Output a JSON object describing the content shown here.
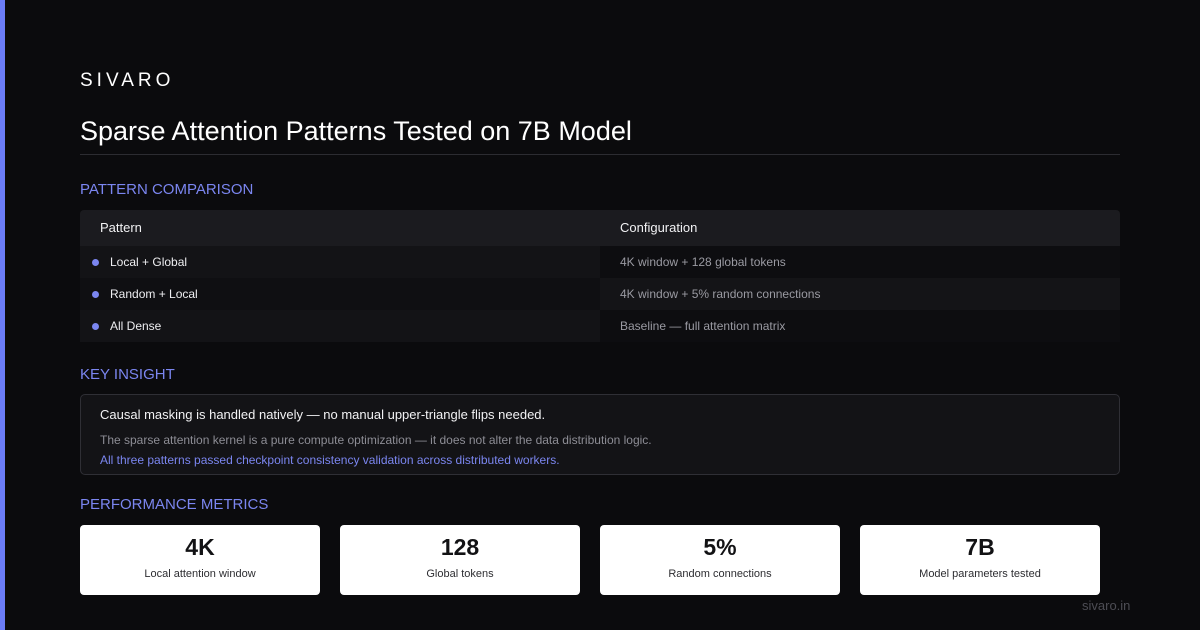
{
  "brand": "SIVARO",
  "title": "Sparse Attention Patterns Tested on 7B Model",
  "colors": {
    "accent": "#7b86f0",
    "background": "#0b0b0d",
    "card": "#ffffff"
  },
  "comparison": {
    "section_label": "PATTERN COMPARISON",
    "headers": [
      "Pattern",
      "Configuration"
    ],
    "rows": [
      {
        "pattern": "Local + Global",
        "config": "4K window + 128 global tokens"
      },
      {
        "pattern": "Random + Local",
        "config": "4K window + 5% random connections"
      },
      {
        "pattern": "All Dense",
        "config": "Baseline — full attention matrix"
      }
    ]
  },
  "insight": {
    "section_label": "KEY INSIGHT",
    "main": "Causal masking is handled natively — no manual upper-triangle flips needed.",
    "sub": "The sparse attention kernel is a pure compute optimization — it does not alter the data distribution logic.",
    "accent": "All three patterns passed checkpoint consistency validation across distributed workers."
  },
  "metrics": {
    "section_label": "PERFORMANCE METRICS",
    "cards": [
      {
        "value": "4K",
        "label": "Local attention window"
      },
      {
        "value": "128",
        "label": "Global tokens"
      },
      {
        "value": "5%",
        "label": "Random connections"
      },
      {
        "value": "7B",
        "label": "Model parameters tested"
      }
    ]
  },
  "footer": "sivaro.in"
}
